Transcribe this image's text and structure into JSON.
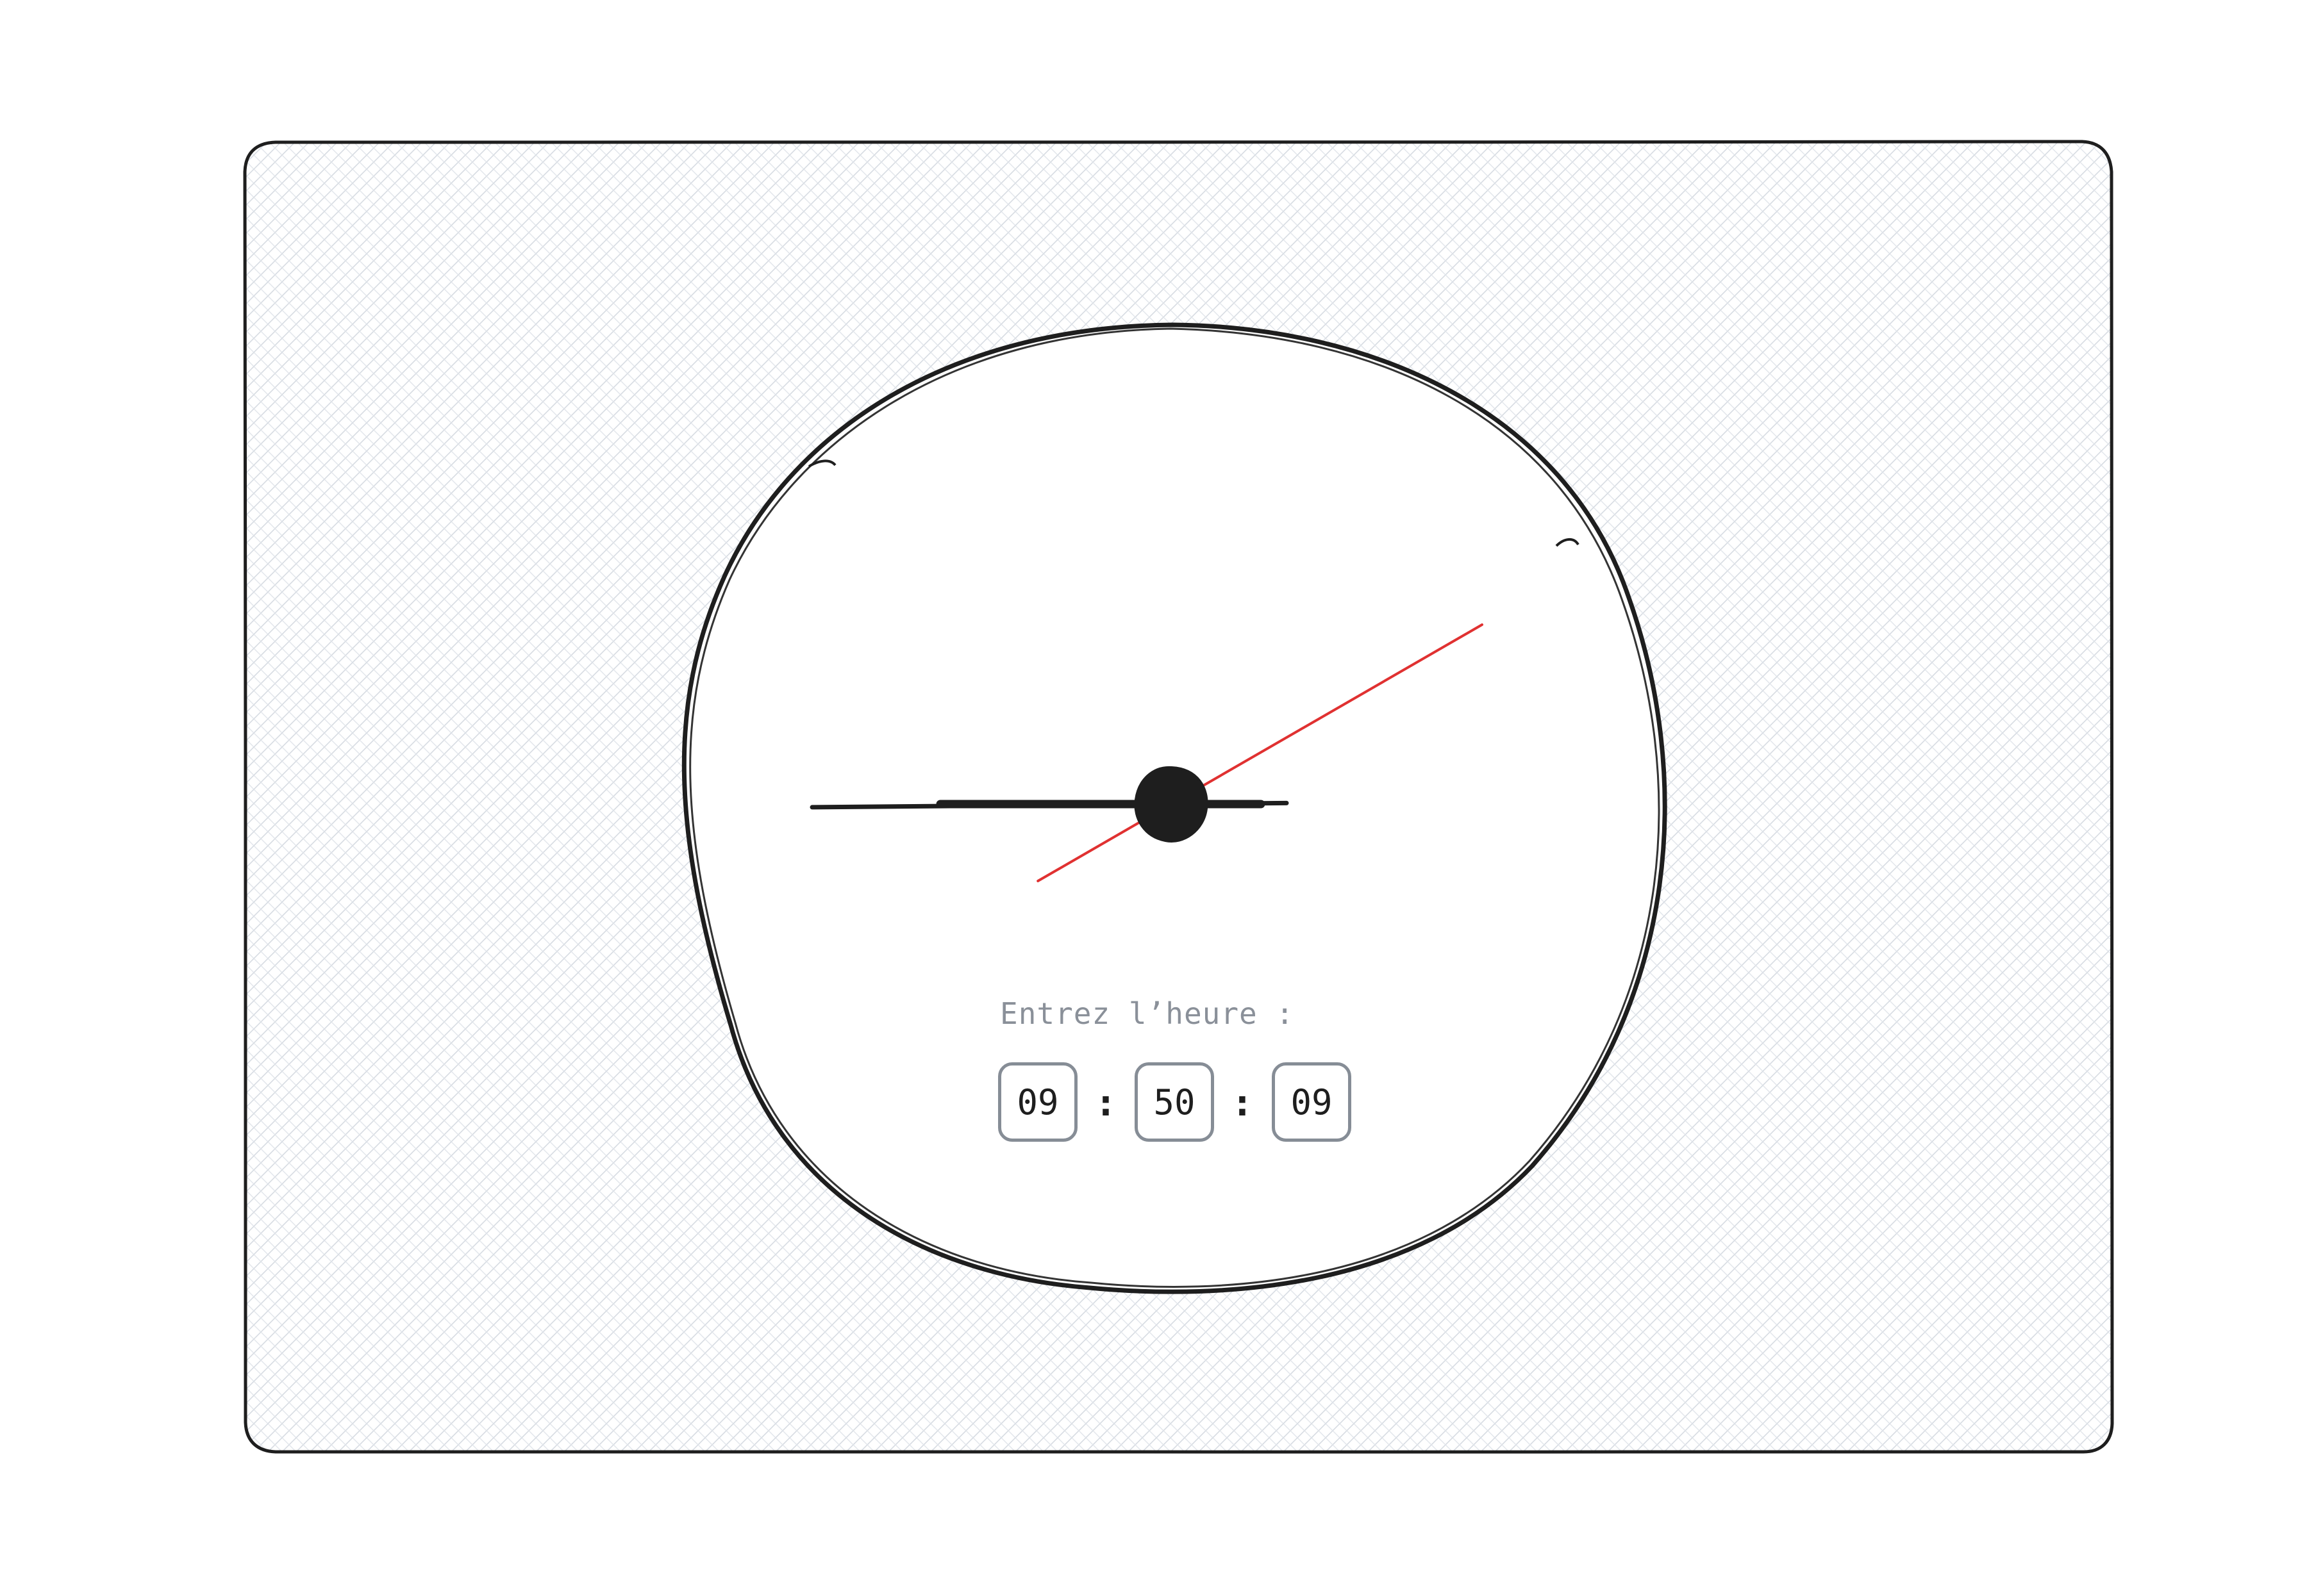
{
  "clock": {
    "time": {
      "hours": 9,
      "minutes": 50,
      "seconds": 9
    },
    "colors": {
      "frame_stroke": "#1e1e1e",
      "hatch": "#d6dbe2",
      "face_fill": "#ffffff",
      "hand": "#1e1e1e",
      "second_hand": "#e03131"
    }
  },
  "form": {
    "label": "Entrez l’heure :",
    "hours": "09",
    "minutes": "50",
    "seconds": "09",
    "separator_1": ":",
    "separator_2": ":"
  }
}
